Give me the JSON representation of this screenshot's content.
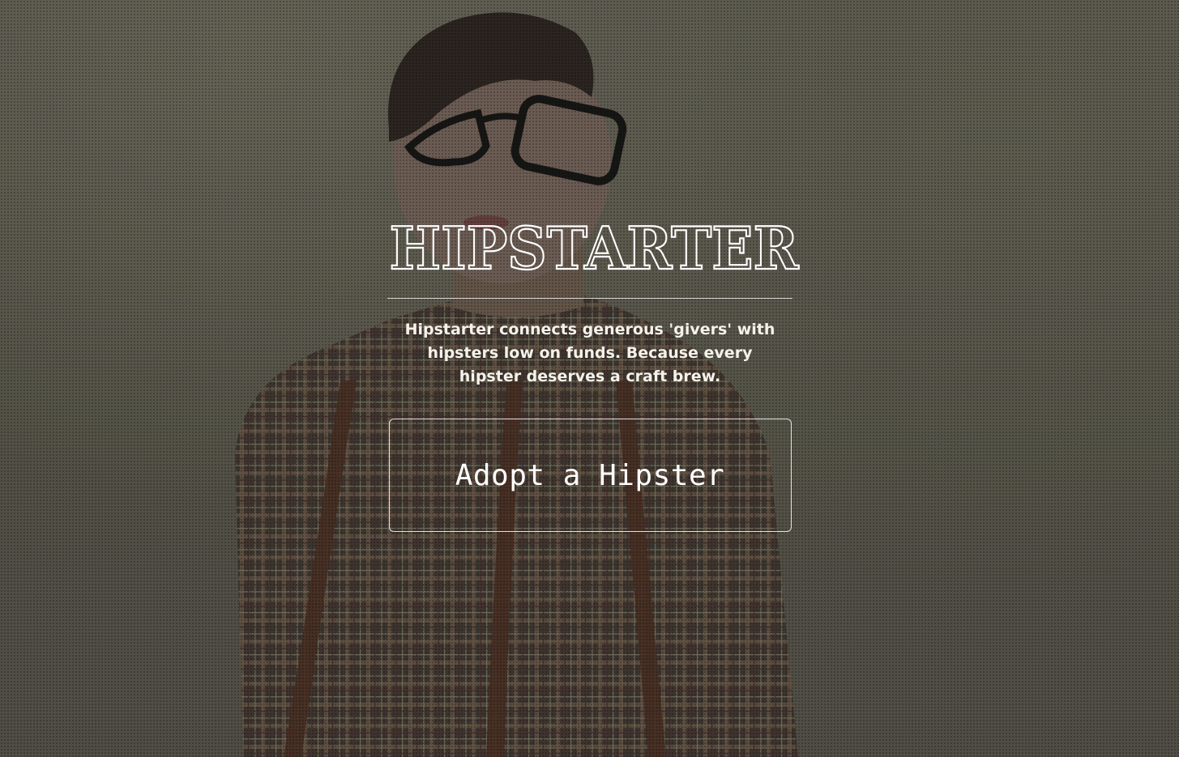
{
  "hero": {
    "logo_text": "HIPSTARTER",
    "tagline": "Hipstarter connects generous 'givers' with hipsters low on funds. Because every hipster deserves a craft brew.",
    "cta_label": "Adopt a Hipster",
    "background_description_color": "#5a584c",
    "accent_color": "#ffffff"
  }
}
